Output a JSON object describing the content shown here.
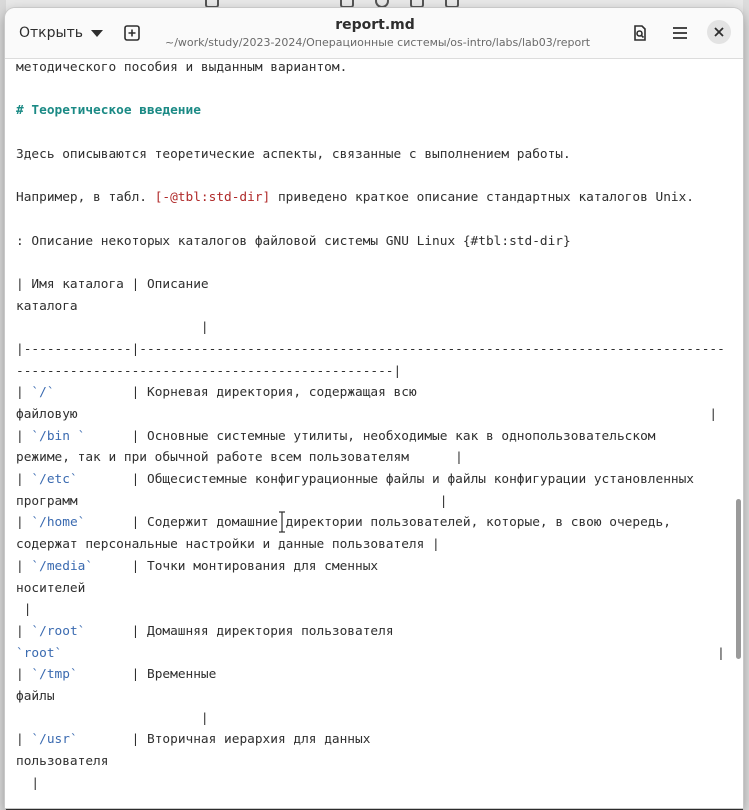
{
  "window": {
    "title": "report.md",
    "path": "~/work/study/2023-2024/Операционные системы/os-intro/labs/lab03/report"
  },
  "toolbar": {
    "open_label": "Открыть",
    "new_tab_icon": "new-document-icon",
    "search_icon": "document-search-icon",
    "menu_icon": "hamburger-menu-icon",
    "close_icon": "close-icon"
  },
  "colors": {
    "heading": "#1b8a85",
    "link": "#b02a2a",
    "code": "#3a6ab0",
    "text": "#2f2f2f"
  },
  "editor": {
    "lines": [
      "методического пособия и выданным вариантом.",
      "",
      "# Теоретическое введение",
      "",
      "Здесь описываются теоретические аспекты, связанные с выполнением работы.",
      "",
      "Например, в табл. [-@tbl:std-dir] приведено краткое описание стандартных каталогов Unix.",
      "",
      ": Описание некоторых каталогов файловой системы GNU Linux {#tbl:std-dir}",
      "",
      "| Имя каталога | Описание",
      "каталога",
      "                        |",
      "|--------------|----------------------------------------------------------------------------",
      "-------------------------------------------------|",
      "| `/`          | Корневая директория, содержащая всю",
      "файловую                                                                                  |",
      "| `/bin `      | Основные системные утилиты, необходимые как в однопользовательском",
      "режиме, так и при обычной работе всем пользователям      |",
      "| `/etc`       | Общесистемные конфигурационные файлы и файлы конфигурации установленных",
      "программ                                               |",
      "| `/home`      | Содержит домашние директории пользователей, которые, в свою очередь,",
      "содержат персональные настройки и данные пользователя |",
      "| `/media`     | Точки монтирования для сменных",
      "носителей",
      " |",
      "| `/root`      | Домашняя директория пользователя",
      "`root`                                                                                     |",
      "| `/tmp`       | Временные",
      "файлы",
      "                        |",
      "| `/usr`       | Вторичная иерархия для данных",
      "пользователя",
      "  |"
    ]
  }
}
